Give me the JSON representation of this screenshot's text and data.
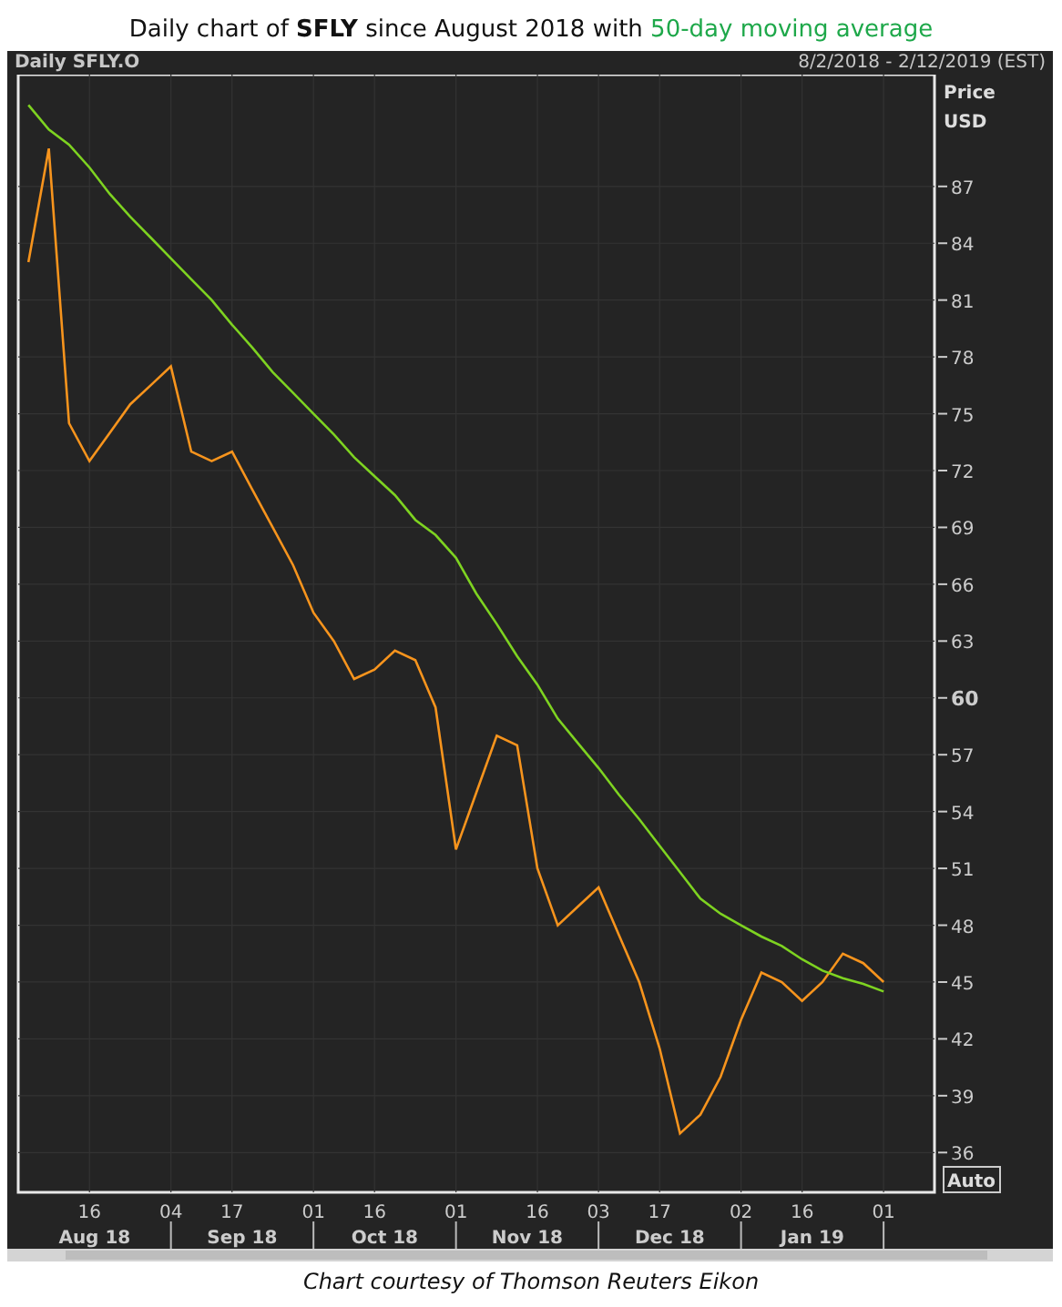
{
  "title": {
    "text": "Daily chart of **SFLY** since August 2018 with ",
    "highlight": "50-day moving average"
  },
  "panel": {
    "name": "Daily SFLY.O",
    "range": "8/2/2018 - 2/12/2019 (EST)",
    "axis_title": "Price",
    "axis_unit": "USD",
    "auto_button": "Auto",
    "bold_ytick": "60",
    "months": [
      {
        "label": "Aug 18"
      },
      {
        "label": "Sep 18"
      },
      {
        "label": "Oct 18"
      },
      {
        "label": "Nov 18"
      },
      {
        "label": "Dec 18"
      },
      {
        "label": "Jan 19"
      }
    ],
    "chart_data": {
      "type": "line",
      "grid": true,
      "categories": [
        null,
        null,
        null,
        "16",
        null,
        null,
        null,
        "04",
        null,
        null,
        "17",
        null,
        null,
        null,
        "01",
        null,
        null,
        "16",
        null,
        null,
        null,
        "01",
        null,
        null,
        null,
        "16",
        null,
        null,
        "03",
        null,
        null,
        "17",
        null,
        null,
        null,
        "02",
        null,
        null,
        "16",
        null,
        null,
        null,
        "01",
        null,
        null
      ],
      "series": [
        {
          "color": "#f7941d",
          "values": [
            83,
            89,
            74.5,
            72.5,
            74,
            75.5,
            76.5,
            77.5,
            73,
            72.5,
            73,
            71,
            69,
            67,
            64.5,
            63,
            61,
            61.5,
            62.5,
            62,
            59.5,
            52,
            55,
            58,
            57.5,
            51,
            48,
            49,
            50,
            47.5,
            45,
            41.5,
            37,
            38,
            40,
            43,
            45.5,
            45,
            44,
            45,
            46.5,
            46,
            45,
            null,
            null
          ]
        },
        {
          "color": "#7ed321",
          "values": [
            91.3,
            90,
            89.2,
            88,
            86.6,
            85.4,
            84.3,
            83.2,
            82.1,
            81,
            79.7,
            78.5,
            77.2,
            76.1,
            75,
            73.9,
            72.7,
            71.7,
            70.7,
            69.4,
            68.6,
            67.4,
            65.5,
            63.9,
            62.2,
            60.7,
            58.9,
            57.6,
            56.3,
            54.9,
            53.6,
            52.2,
            50.8,
            49.4,
            48.6,
            48,
            47.4,
            46.9,
            46.2,
            45.6,
            45.2,
            44.9,
            44.5,
            null,
            null
          ]
        }
      ],
      "ylim": [
        33.9,
        92.9
      ],
      "yticks": [
        36,
        39,
        42,
        45,
        48,
        51,
        54,
        57,
        60,
        63,
        66,
        69,
        72,
        75,
        78,
        81,
        84,
        87
      ]
    }
  },
  "caption": "Chart courtesy of Thomson Reuters Eikon"
}
